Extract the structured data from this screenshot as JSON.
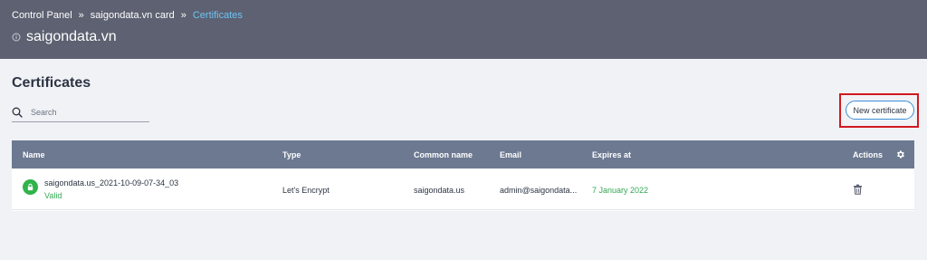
{
  "breadcrumb": {
    "items": [
      "Control Panel",
      "saigondata.vn card",
      "Certificates"
    ],
    "separator": "»"
  },
  "site": {
    "name": "saigondata.vn",
    "icon": "info-circle-icon"
  },
  "page": {
    "title": "Certificates"
  },
  "search": {
    "placeholder": "Search",
    "value": ""
  },
  "toolbar": {
    "new_certificate_label": "New certificate"
  },
  "table": {
    "columns": [
      "Name",
      "Type",
      "Common name",
      "Email",
      "Expires at",
      "Actions"
    ],
    "rows": [
      {
        "name": "saigondata.us_2021-10-09-07-34_03",
        "status": "Valid",
        "type": "Let's Encrypt",
        "common_name": "saigondata.us",
        "email": "admin@saigondata...",
        "expires_at": "7 January 2022",
        "status_icon": "lock-icon",
        "action_icon": "trash-icon"
      }
    ],
    "settings_icon": "gear-icon"
  },
  "colors": {
    "header_bg": "#5d6171",
    "table_header_bg": "#6c7991",
    "accent": "#6dc3f2",
    "valid_green": "#34a853",
    "highlight_red": "#d0191f"
  }
}
